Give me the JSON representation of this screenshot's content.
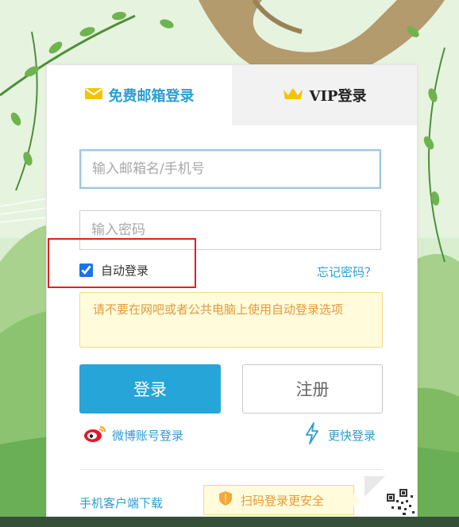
{
  "tabs": {
    "free": {
      "label": "免费邮箱登录",
      "icon": "envelope-icon"
    },
    "vip": {
      "label": "VIP登录",
      "icon": "crown-icon"
    }
  },
  "form": {
    "email_placeholder": "输入邮箱名/手机号",
    "email_value": "",
    "password_placeholder": "输入密码",
    "password_value": "",
    "auto_login_label": "自动登录",
    "auto_login_checked": true,
    "forgot_password": "忘记密码？",
    "warning": "请不要在网吧或者公共电脑上使用自动登录选项",
    "login_button": "登录",
    "register_button": "注册"
  },
  "alt_login": {
    "weibo": {
      "label": "微博账号登录",
      "icon": "weibo-icon"
    },
    "fast": {
      "label": "更快登录",
      "icon": "lightning-icon"
    }
  },
  "footer": {
    "mobile_download": "手机客户端下载",
    "qr_tip": "扫码登录更安全",
    "qr_tip_icon": "shield-icon",
    "qr_icon": "qr-code-icon"
  },
  "colors": {
    "accent": "#26a5d8",
    "link": "#2a9fd0",
    "warning_bg": "#fffbdb",
    "warning_text": "#e39a3e",
    "highlight": "#e02020",
    "crown": "#f5c400"
  }
}
